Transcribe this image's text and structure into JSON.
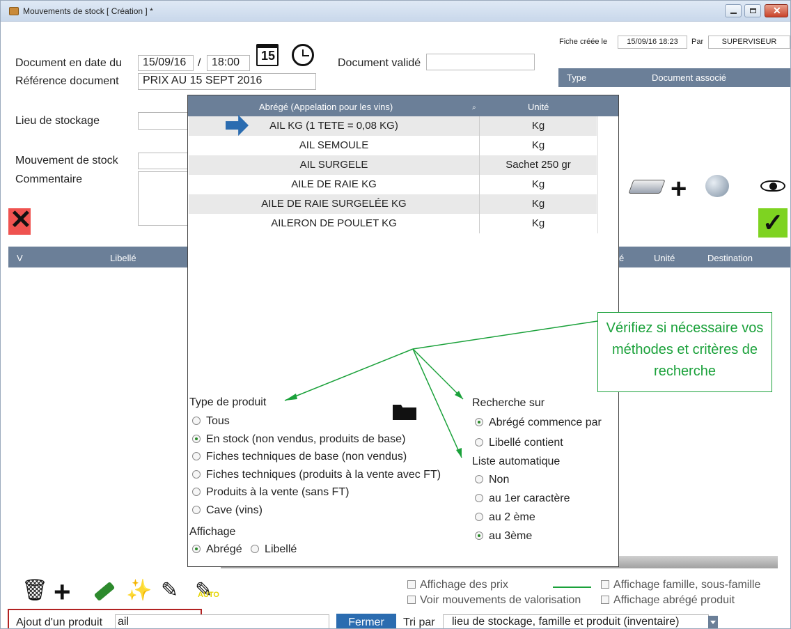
{
  "window": {
    "title": "Mouvements de stock [ Création ] *"
  },
  "header": {
    "created_label": "Fiche créée le",
    "created_value": "15/09/16 18:23",
    "by_label": "Par",
    "by_value": "SUPERVISEUR",
    "date_label": "Document en date du",
    "date_value": "15/09/16",
    "slash": "/",
    "time_value": "18:00",
    "calendar_day": "15",
    "validated_label": "Document validé",
    "reference_label": "Référence document",
    "reference_value": "PRIX AU 15 SEPT 2016",
    "storage_label": "Lieu de stockage",
    "movement_label": "Mouvement de stock",
    "comment_label": "Commentaire"
  },
  "assoc_table": {
    "col_type": "Type",
    "col_doc": "Document associé"
  },
  "main_table": {
    "col_v": "V",
    "col_libelle": "Libellé",
    "col_e": "é",
    "col_unite": "Unité",
    "col_destination": "Destination"
  },
  "popup": {
    "col_abrege": "Abrégé (Appelation pour les vins)",
    "col_unite": "Unité",
    "rows": [
      {
        "abrege": "AIL KG (1 TETE = 0,08 KG)",
        "unite": "Kg"
      },
      {
        "abrege": "AIL SEMOULE",
        "unite": "Kg"
      },
      {
        "abrege": "AIL SURGELE",
        "unite": "Sachet 250 gr"
      },
      {
        "abrege": "AILE DE RAIE KG",
        "unite": "Kg"
      },
      {
        "abrege": "AILE DE RAIE SURGELÉE KG",
        "unite": "Kg"
      },
      {
        "abrege": "AILERON DE POULET KG",
        "unite": "Kg"
      }
    ],
    "type_title": "Type de produit",
    "type_options": [
      "Tous",
      "En stock (non vendus, produits de base)",
      "Fiches techniques de base (non vendus)",
      "Fiches techniques (produits à la vente avec FT)",
      "Produits à la vente (sans FT)",
      "Cave (vins)"
    ],
    "search_title": "Recherche sur",
    "search_options": [
      "Abrégé commence par",
      "Libellé contient"
    ],
    "auto_title": "Liste automatique",
    "auto_options": [
      "Non",
      "au 1er caractère",
      "au 2 ème",
      "au 3ème"
    ],
    "display_title": "Affichage",
    "display_options": [
      "Abrégé",
      "Libellé"
    ]
  },
  "callout": {
    "text": "Vérifiez si nécessaire vos méthodes et critères de recherche"
  },
  "toolbar": {
    "auto_label": "AUTO"
  },
  "checks": {
    "prices": "Affichage des prix",
    "valorisation": "Voir mouvements de valorisation",
    "family": "Affichage famille, sous-famille",
    "abrege": "Affichage abrégé produit"
  },
  "bottom": {
    "add_label": "Ajout d'un produit",
    "add_value": "ail",
    "close_button": "Fermer",
    "sort_label": "Tri par",
    "sort_value": "lieu de stockage, famille et produit (inventaire)"
  },
  "colors": {
    "header": "#6b7f98",
    "accent": "#2b6cb0",
    "callout": "#1aa13a",
    "close": "#ef5350",
    "ok": "#7ed321"
  }
}
